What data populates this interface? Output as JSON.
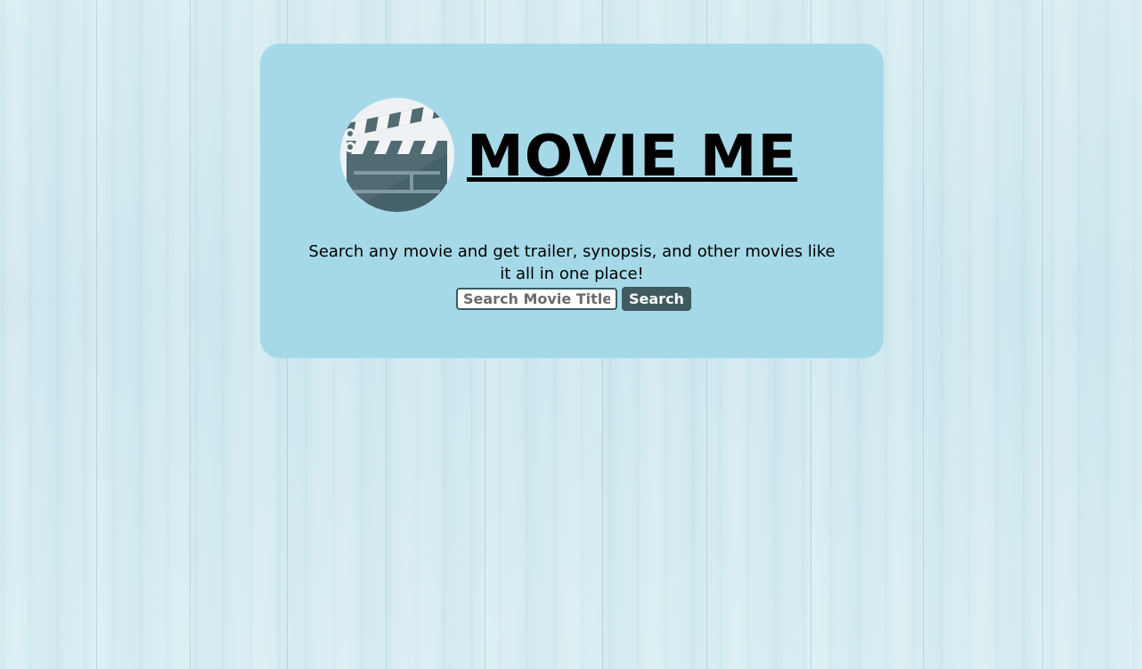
{
  "app": {
    "title": "MOVIE ME",
    "tagline": "Search any movie and get trailer, synopsis, and other movies like it all in one place!"
  },
  "logo": {
    "icon": "clapperboard-icon"
  },
  "search": {
    "placeholder": "Search Movie Titles",
    "button_label": "Search"
  },
  "colors": {
    "background": "#d2eaf0",
    "card": "#a6d9e7",
    "button": "#3f5b5f",
    "input_border": "#3b5b63",
    "clapper_dark": "#506b72",
    "clapper_mid": "#60808a",
    "clapper_light": "#f2f4f6"
  }
}
